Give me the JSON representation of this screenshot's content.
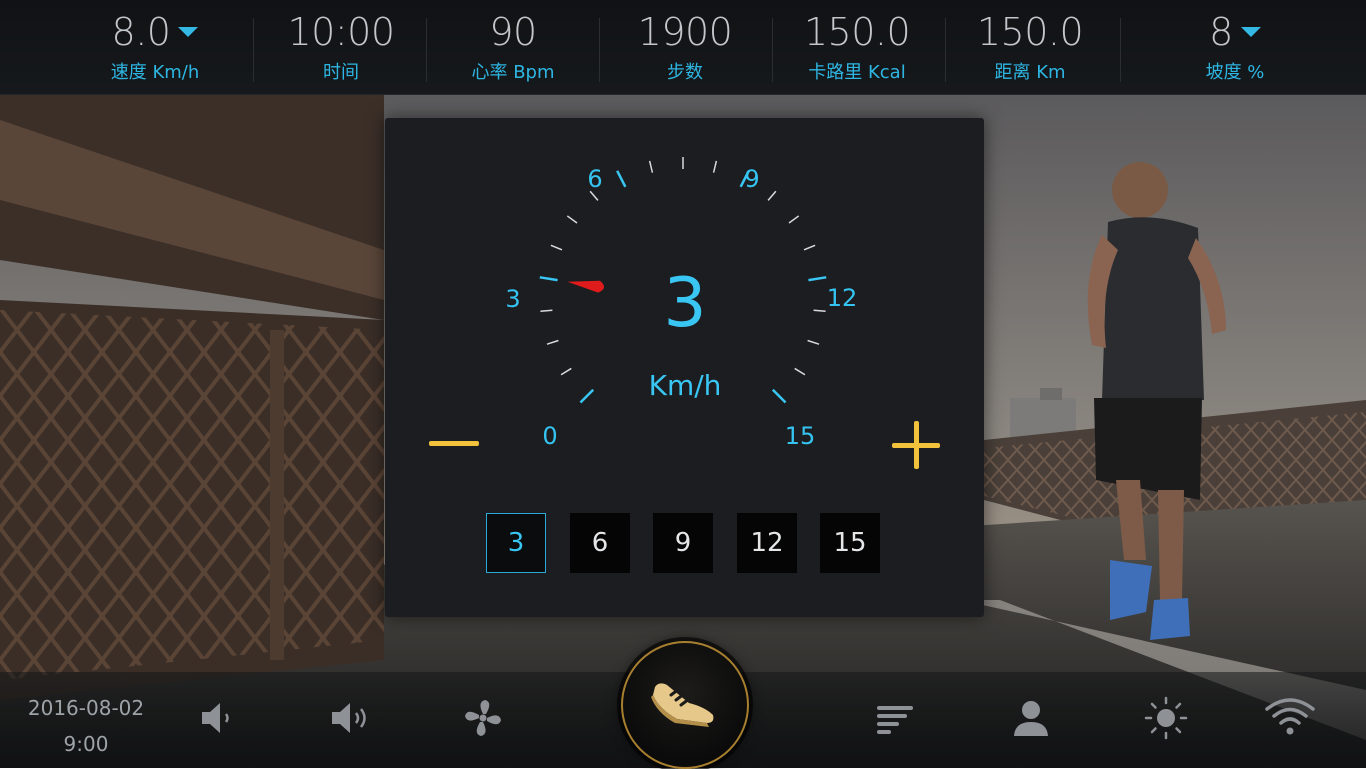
{
  "stats": [
    {
      "value": "8.0",
      "label": "速度 Km/h",
      "has_dropdown": true
    },
    {
      "value": "10:00",
      "label": "时间"
    },
    {
      "value": "90",
      "label": "心率 Bpm"
    },
    {
      "value": "1900",
      "label": "步数"
    },
    {
      "value": "150.0",
      "label": "卡路里 Kcal"
    },
    {
      "value": "150.0",
      "label": "距离 Km"
    },
    {
      "value": "8",
      "label": "坡度 %",
      "has_dropdown": true
    }
  ],
  "speed_dialog": {
    "current_speed": "3",
    "unit": "Km/h",
    "needle_value": 3,
    "dial_range": [
      0,
      15
    ],
    "dial_numbers": [
      "0",
      "3",
      "6",
      "9",
      "12",
      "15"
    ],
    "presets": [
      "3",
      "6",
      "9",
      "12",
      "15"
    ],
    "active_preset": "3"
  },
  "bottom": {
    "date": "2016-08-02",
    "time": "9:00"
  },
  "colors": {
    "accent_blue": "#35c3f0",
    "button_yellow": "#f2c23d",
    "needle_red": "#e01b1b",
    "start_ring_gold": "#a77f2f"
  },
  "icons": [
    "volume-down-icon",
    "volume-up-icon",
    "fan-icon",
    "running-shoe-icon",
    "list-menu-icon",
    "user-icon",
    "brightness-icon",
    "wifi-icon"
  ]
}
